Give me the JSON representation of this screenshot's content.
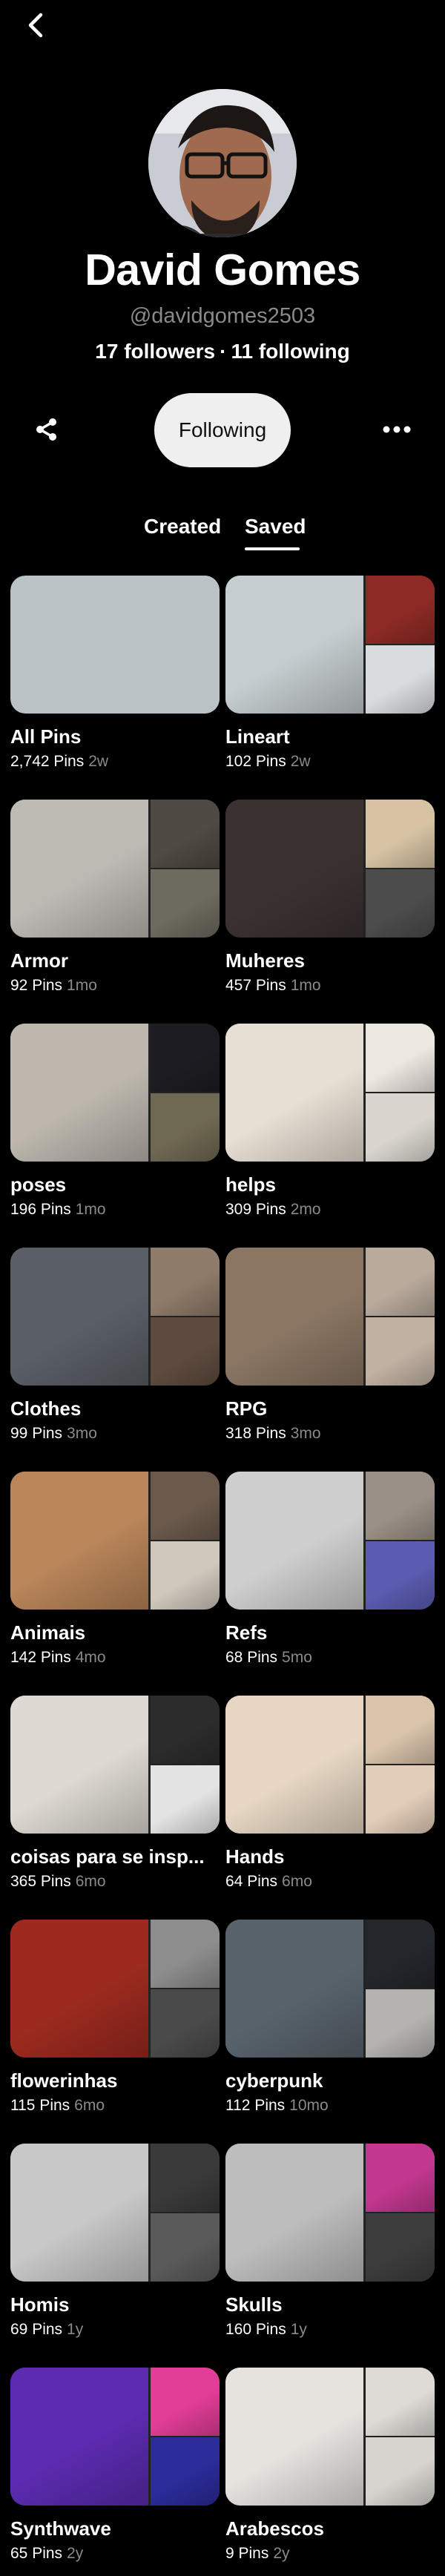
{
  "profile": {
    "name": "David Gomes",
    "handle": "@davidgomes2503",
    "followers": "17 followers",
    "separator": "·",
    "following_count": "11 following",
    "following_button": "Following"
  },
  "icons": {
    "back": "chevron-left-icon",
    "share": "share-icon",
    "more": "more-horizontal-icon"
  },
  "tabs": [
    {
      "label": "Created",
      "active": false
    },
    {
      "label": "Saved",
      "active": true
    }
  ],
  "boards": [
    {
      "title": "All Pins",
      "pins": "2,742 Pins",
      "ago": "2w",
      "colors": [
        "#b9c3c6",
        "#d7cbb3",
        "#9aa3a6"
      ]
    },
    {
      "title": "Lineart",
      "pins": "102 Pins",
      "ago": "2w",
      "colors": [
        "#c5cdd0",
        "#8e2a25",
        "#d9dcdf"
      ]
    },
    {
      "title": "Armor",
      "pins": "92 Pins",
      "ago": "1mo",
      "colors": [
        "#bdbab4",
        "#4f4a42",
        "#6d6a5f"
      ]
    },
    {
      "title": "Muheres",
      "pins": "457 Pins",
      "ago": "1mo",
      "colors": [
        "#3b3131",
        "#d7c3a4",
        "#4c4c4c"
      ]
    },
    {
      "title": "poses",
      "pins": "196 Pins",
      "ago": "1mo",
      "colors": [
        "#bdb7ae",
        "#1c1c22",
        "#6f6852"
      ]
    },
    {
      "title": "helps",
      "pins": "309 Pins",
      "ago": "2mo",
      "colors": [
        "#e7dfd4",
        "#ede7e1",
        "#dad6cf"
      ]
    },
    {
      "title": "Clothes",
      "pins": "99 Pins",
      "ago": "3mo",
      "colors": [
        "#5a5f66",
        "#8f7b69",
        "#5e4b3f"
      ]
    },
    {
      "title": "RPG",
      "pins": "318 Pins",
      "ago": "3mo",
      "colors": [
        "#8a7663",
        "#b9aa9c",
        "#c1b1a3"
      ]
    },
    {
      "title": "Animais",
      "pins": "142 Pins",
      "ago": "4mo",
      "colors": [
        "#b98559",
        "#6b5a4c",
        "#d0c7bd"
      ]
    },
    {
      "title": "Refs",
      "pins": "68 Pins",
      "ago": "5mo",
      "colors": [
        "#cfcfcf",
        "#9b9088",
        "#5b5bb1"
      ]
    },
    {
      "title": "coisas para se insp...",
      "pins": "365 Pins",
      "ago": "6mo",
      "colors": [
        "#dedad2",
        "#2c2c2c",
        "#e3e3e3"
      ]
    },
    {
      "title": "Hands",
      "pins": "64 Pins",
      "ago": "6mo",
      "colors": [
        "#e7d7c4",
        "#d9c3ab",
        "#e2cdb8"
      ]
    },
    {
      "title": "flowerinhas",
      "pins": "115 Pins",
      "ago": "6mo",
      "colors": [
        "#9c2a1f",
        "#8d8d8d",
        "#4a4a4a"
      ]
    },
    {
      "title": "cyberpunk",
      "pins": "112 Pins",
      "ago": "10mo",
      "colors": [
        "#59636c",
        "#23262b",
        "#b5b3b0"
      ]
    },
    {
      "title": "Homis",
      "pins": "69 Pins",
      "ago": "1y",
      "colors": [
        "#c8c8c8",
        "#3a3a3a",
        "#5a5a5a"
      ]
    },
    {
      "title": "Skulls",
      "pins": "160 Pins",
      "ago": "1y",
      "colors": [
        "#bdbdbd",
        "#c2378f",
        "#3c3c3c"
      ]
    },
    {
      "title": "Synthwave",
      "pins": "65 Pins",
      "ago": "2y",
      "colors": [
        "#5b2bb0",
        "#e23d97",
        "#2b2b9a"
      ]
    },
    {
      "title": "Arabescos",
      "pins": "9 Pins",
      "ago": "2y",
      "colors": [
        "#e6e3df",
        "#dedbd6",
        "#d7d4cf"
      ]
    }
  ]
}
